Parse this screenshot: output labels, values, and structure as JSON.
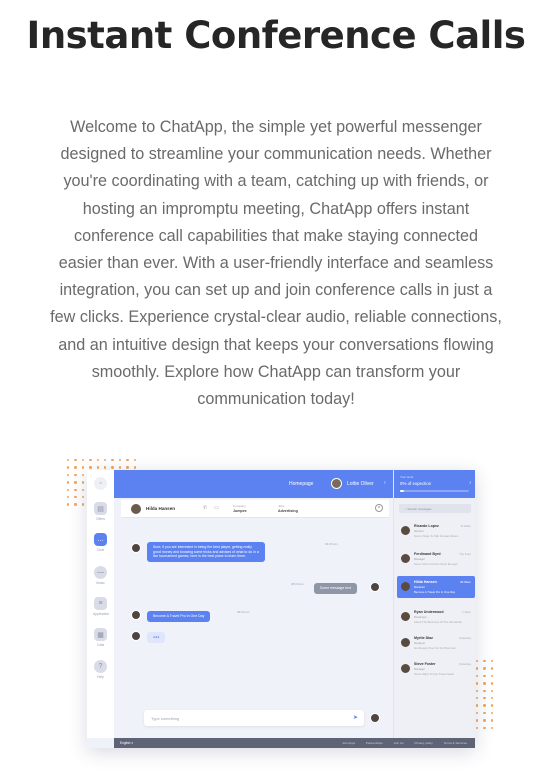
{
  "hero": {
    "title": "Instant Conference Calls",
    "body": "Welcome to ChatApp, the simple yet powerful messenger designed to streamline your communication needs. Whether you're coordinating with a team, catching up with friends, or hosting an impromptu meeting, ChatApp offers instant conference call capabilities that make staying connected easier than ever. With a user-friendly interface and seamless integration, you can set up and join conference calls in just a few clicks. Experience crystal-clear audio, reliable connections, and an intuitive design that keeps your conversations flowing smoothly. Explore how ChatApp can transform your communication today!"
  },
  "colors": {
    "accent": "#5b82f0",
    "dots": "#f2a65a",
    "footer": "#5e6476"
  },
  "app": {
    "rail": [
      {
        "label": "",
        "icon": "logo-icon"
      },
      {
        "label": "Offers",
        "icon": "briefcase-icon"
      },
      {
        "label": "Chat",
        "icon": "chat-icon"
      },
      {
        "label": "Music",
        "icon": "music-icon"
      },
      {
        "label": "Application",
        "icon": "document-icon"
      },
      {
        "label": "Calls",
        "icon": "calendar-icon"
      },
      {
        "label": "Help",
        "icon": "help-icon"
      }
    ],
    "topbar": {
      "homepage": "Homepage",
      "user": "Lottie Oliver",
      "chevron": "›"
    },
    "chat_header": {
      "name": "Hilda Hansen",
      "company_label": "Company",
      "company": "Jumpee",
      "jobs_label": "Jobs",
      "jobs": "Advertising",
      "close": "×"
    },
    "messages": [
      {
        "text": "Sure, if you are interested in being the best player, getting really good money and knowing some tricks and advises of what to do in a live tournament games, here is the best place to learn them.",
        "time": "03:00 am"
      },
      {
        "text": "Some message text",
        "time": "08:00 am"
      },
      {
        "text": "Become A Travel Pro In One Day",
        "time": "08:00 am"
      },
      {
        "text": "●●●"
      }
    ],
    "composer": {
      "placeholder": "Type something",
      "send": "➤"
    },
    "side": {
      "progress_small": "Your work",
      "progress_title": "0% of expection",
      "progress_value": 0.06,
      "search_placeholder": "Search messages",
      "contacts": [
        {
          "name": "Ricardo Lopez",
          "role": "Director",
          "msg": "Some things To Talk Forward About...",
          "time": "11:22am"
        },
        {
          "name": "Ferdinand Byrd",
          "role": "Manager",
          "msg": "Some Short And Not Short Enough",
          "time": "Tue 9:am"
        },
        {
          "name": "Hilda Hansen",
          "role": "Marketer",
          "msg": "Become A Travel Pro In One Day",
          "time": "09:45am"
        },
        {
          "name": "Ryan Underwood",
          "role": "Developer",
          "msg": "About The Business Of The Wonderful",
          "time": "7:11am"
        },
        {
          "name": "Myrtle Diaz",
          "role": "Designer",
          "msg": "Get Ready Over For Full Summer",
          "time": "Yesterday"
        },
        {
          "name": "Steve Foster",
          "role": "Manager",
          "msg": "Some Ways To Get Travel Ideas",
          "time": "Yesterday"
        }
      ]
    },
    "footer": {
      "language": "English ▾",
      "links": [
        "Join Apps",
        "Partnerships",
        "Join Us",
        "Privacy policy",
        "Terms & Services"
      ]
    }
  }
}
